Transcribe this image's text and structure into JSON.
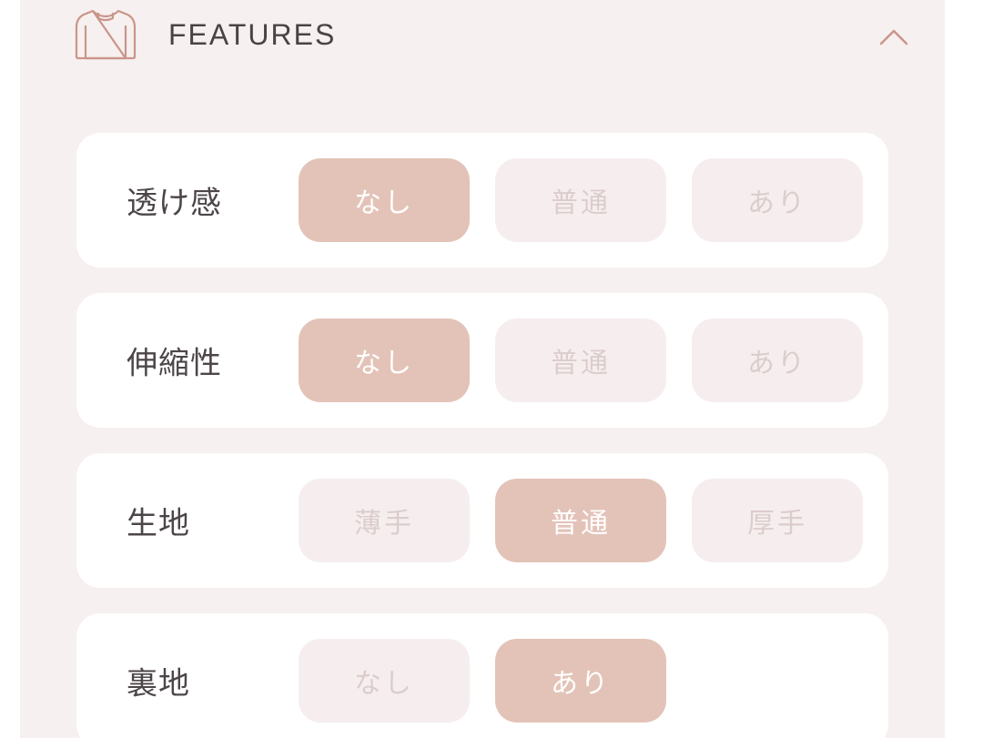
{
  "header": {
    "title": "FEATURES",
    "icon": "shirt-icon",
    "collapse_icon": "chevron-up-icon"
  },
  "colors": {
    "panel_bg": "#f7f0f0",
    "selected_bg": "#e3c3b8",
    "unselected_bg": "#f6eeee",
    "unselected_text": "#dccdcd",
    "label_text": "#4d4649"
  },
  "features": [
    {
      "label": "透け感",
      "options": [
        "なし",
        "普通",
        "あり"
      ],
      "selected": "なし"
    },
    {
      "label": "伸縮性",
      "options": [
        "なし",
        "普通",
        "あり"
      ],
      "selected": "なし"
    },
    {
      "label": "生地",
      "options": [
        "薄手",
        "普通",
        "厚手"
      ],
      "selected": "普通"
    },
    {
      "label": "裏地",
      "options": [
        "なし",
        "あり"
      ],
      "selected": "あり"
    }
  ]
}
